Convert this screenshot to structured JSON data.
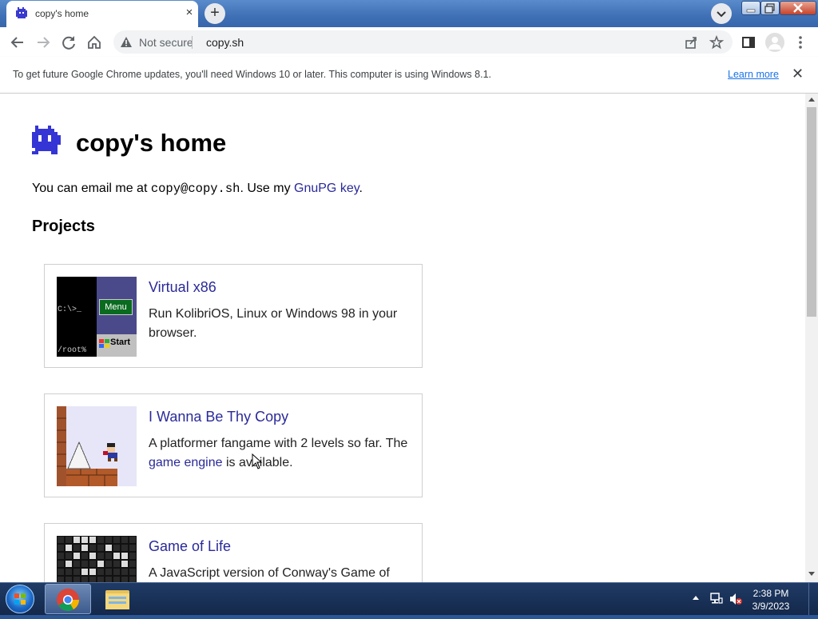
{
  "browser": {
    "tab_title": "copy's home",
    "tab_close_icon": "×",
    "new_tab_icon": "+",
    "security_label": "Not secure",
    "url": "copy.sh"
  },
  "infobar": {
    "message": "To get future Google Chrome updates, you'll need Windows 10 or later. This computer is using Windows 8.1.",
    "link_label": "Learn more",
    "close_icon": "✕"
  },
  "page": {
    "title": "copy's home",
    "email_prefix": "You can email me at ",
    "email": "copy@copy.sh",
    "email_suffix": ". Use my ",
    "gnupg_link": "GnuPG key",
    "email_end": ".",
    "projects_heading": "Projects",
    "projects": [
      {
        "title": "Virtual x86",
        "description": "Run KolibriOS, Linux or Windows 98 in your browser."
      },
      {
        "title": "I Wanna Be Thy Copy",
        "description_before": "A platformer fangame with 2 levels so far. The ",
        "description_link": "game engine",
        "description_after": " is available."
      },
      {
        "title": "Game of Life",
        "description": "A JavaScript version of Conway's Game of"
      }
    ],
    "thumb_v86": {
      "prompt": "C:\\>_",
      "menu": "Menu",
      "root": "/root%",
      "start": "Start"
    }
  },
  "taskbar": {
    "time": "2:38 PM",
    "date": "3/9/2023"
  },
  "colors": {
    "link": "#2a2a9a",
    "chrome_accent": "#1a73e8",
    "taskbar": "#1a3358"
  }
}
